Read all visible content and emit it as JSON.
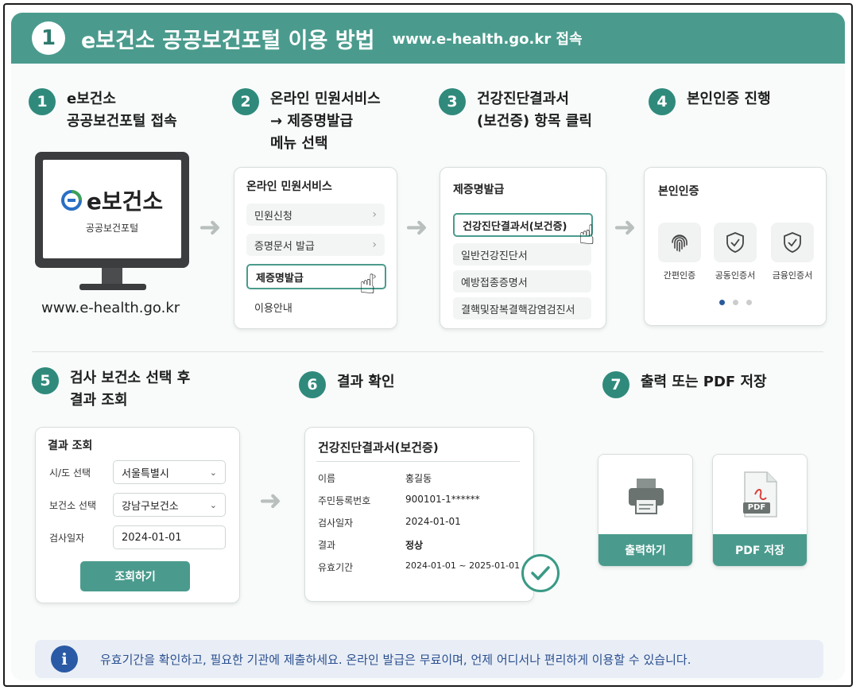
{
  "header": {
    "number": "1",
    "title": "e보건소 공공보건포털 이용 방법",
    "subtitle": "www.e-health.go.kr 접속"
  },
  "steps": [
    {
      "num": "1",
      "lines": [
        "e보건소",
        "공공보건포털 접속"
      ]
    },
    {
      "num": "2",
      "lines": [
        "온라인 민원서비스",
        "→ 제증명발급",
        "메뉴 선택"
      ]
    },
    {
      "num": "3",
      "lines": [
        "건강진단결과서",
        "(보건증) 항목 클릭"
      ]
    },
    {
      "num": "4",
      "lines": [
        "본인인증 진행"
      ]
    },
    {
      "num": "5",
      "lines": [
        "검사 보건소 선택 후",
        "결과 조회"
      ]
    },
    {
      "num": "6",
      "lines": [
        "결과 확인"
      ]
    },
    {
      "num": "7",
      "lines": [
        "출력 또는 PDF 저장"
      ]
    }
  ],
  "monitor": {
    "logo_text": "e보건소",
    "logo_sub": "공공보건포털",
    "url": "www.e-health.go.kr"
  },
  "online_panel": {
    "title": "온라인 민원서비스",
    "items": [
      "민원신청",
      "증명문서 발급",
      "제증명발급",
      "이용안내"
    ]
  },
  "cert_panel": {
    "title": "제증명발급",
    "items": [
      "건강진단결과서(보건증)",
      "일반건강진단서",
      "예방접종증명서",
      "결핵및잠복결핵감염검진서"
    ]
  },
  "auth_panel": {
    "title": "본인인증",
    "options": [
      {
        "label": "간편인증",
        "icon": "fingerprint-icon"
      },
      {
        "label": "공동인증서",
        "icon": "shield-check-icon"
      },
      {
        "label": "금융인증서",
        "icon": "shield-check-icon"
      }
    ]
  },
  "query_panel": {
    "title": "결과 조회",
    "fields": [
      {
        "label": "시/도 선택",
        "value": "서울특별시"
      },
      {
        "label": "보건소 선택",
        "value": "강남구보건소"
      },
      {
        "label": "검사일자",
        "value": "2024-01-01"
      }
    ],
    "button": "조회하기"
  },
  "result_panel": {
    "title": "건강진단결과서(보건증)",
    "rows": [
      {
        "k": "이름",
        "v": "홍길동"
      },
      {
        "k": "주민등록번호",
        "v": "900101-1******"
      },
      {
        "k": "검사일자",
        "v": "2024-01-01"
      },
      {
        "k": "결과",
        "v": "정상"
      },
      {
        "k": "유효기간",
        "v": "2024-01-01 ~ 2025-01-01"
      }
    ]
  },
  "output": {
    "print_label": "출력하기",
    "pdf_label": "PDF 저장",
    "pdf_badge": "PDF"
  },
  "info_text": "유효기간을 확인하고, 필요한 기관에 제출하세요. 온라인 발급은 무료이며, 언제 어디서나 편리하게 이용할 수 있습니다.",
  "colors": {
    "primary": "#4a9b8d",
    "step_circle": "#2f8a7c",
    "info_bg": "#e9eef6",
    "info_icon": "#2a5aa5"
  }
}
